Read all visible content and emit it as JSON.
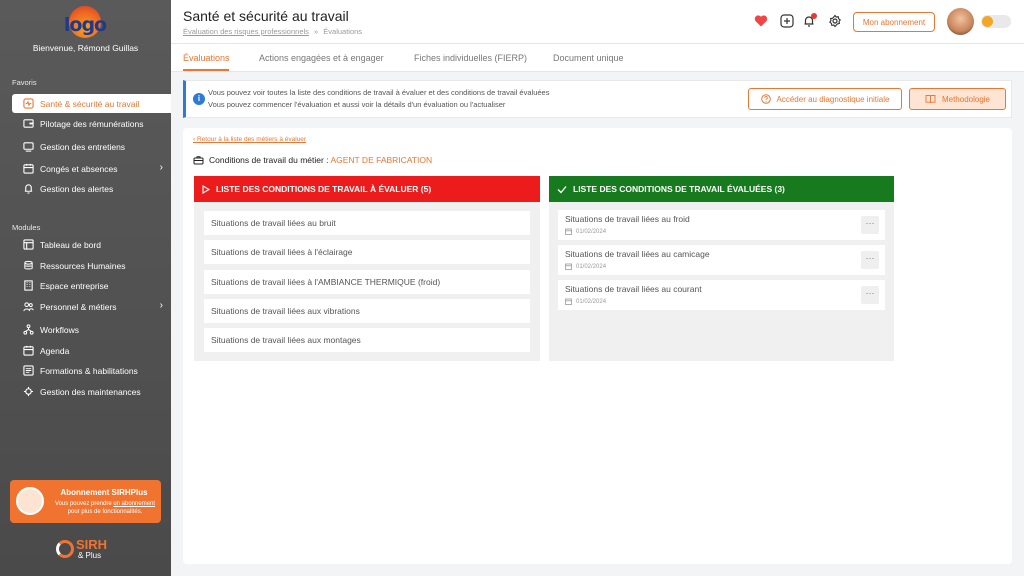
{
  "sidebar": {
    "logo_text": "logo",
    "welcome": "Bienvenue, Rémond Guillas",
    "favoris_title": "Favoris",
    "favoris": [
      {
        "label": "Santé & sécurité au travail",
        "icon": "health-icon",
        "active": true
      },
      {
        "label": "Pilotage des rémunérations",
        "icon": "wallet-icon"
      },
      {
        "label": "Gestion des entretiens",
        "icon": "interview-icon"
      },
      {
        "label": "Congés et absences",
        "icon": "calendar-icon",
        "chevron": "›"
      },
      {
        "label": "Gestion des alertes",
        "icon": "bell-icon"
      }
    ],
    "modules_title": "Modules",
    "modules": [
      {
        "label": "Tableau de bord",
        "icon": "dashboard-icon"
      },
      {
        "label": "Ressources Humaines",
        "icon": "hr-icon"
      },
      {
        "label": "Espace entreprise",
        "icon": "building-icon"
      },
      {
        "label": "Personnel & métiers",
        "icon": "people-icon",
        "chevron": "›"
      },
      {
        "label": "Workflows",
        "icon": "workflow-icon"
      },
      {
        "label": "Agenda",
        "icon": "agenda-icon"
      },
      {
        "label": "Formations & habilitations",
        "icon": "training-icon"
      },
      {
        "label": "Gestion des maintenances",
        "icon": "maintenance-icon"
      }
    ],
    "promo": {
      "title": "Abonnement SIRHPlus",
      "text_before": "Vous pouvez prendre ",
      "link": "un abonnement",
      "text_after": " pour plus de fonctionnalités."
    },
    "brand": {
      "name": "SIRH",
      "sub": "& Plus"
    }
  },
  "header": {
    "title": "Santé et sécurité au travail",
    "breadcrumb": [
      "Évaluation des risques professionnels",
      "Évaluations"
    ],
    "breadcrumb_sep": "»",
    "subscription_button": "Mon abonnement"
  },
  "tabs": [
    {
      "label": "Évaluations",
      "active": true
    },
    {
      "label": "Actions engagées et à engager"
    },
    {
      "label": "Fiches individuelles (FIERP)"
    },
    {
      "label": "Document unique"
    }
  ],
  "info": {
    "icon_glyph": "i",
    "line1": "Vous pouvez voir toutes la liste des conditions de travail à évaluer et des conditions de travail évaluées",
    "line2": "Vous pouvez commencer l'évaluation et aussi voir la détails d'un évaluation ou l'actualiser",
    "diag_button": "Accéder au diagnostique initiale",
    "method_button": "Methodologie"
  },
  "main": {
    "back_link": "Retour à la liste des métiers à évaluer",
    "job_label": "Conditions de travail du métier : ",
    "job_name": "AGENT DE FABRICATION",
    "to_evaluate": {
      "title": "LISTE DES CONDITIONS DE TRAVAIL À ÉVALUER (5)",
      "items": [
        "Situations de travail liées au bruit",
        "Situations de travail liées à l'éclairage",
        "Situations de travail liées à l'AMBIANCE THERMIQUE (froid)",
        "Situations de travail liées aux vibrations",
        "Situations de travail liées aux montages"
      ]
    },
    "evaluated": {
      "title": "LISTE DES CONDITIONS DE TRAVAIL ÉVALUÉES (3)",
      "items": [
        {
          "label": "Situations de travail liées au froid",
          "date": "01/02/2024"
        },
        {
          "label": "Situations de travail liées au camicage",
          "date": "01/02/2024"
        },
        {
          "label": "Situations de travail liées au courant",
          "date": "01/02/2024"
        }
      ],
      "menu_glyph": "···"
    }
  },
  "colors": {
    "accent": "#f07330",
    "red": "#ed1c1c",
    "green": "#177a1e",
    "info": "#2e7bd6"
  }
}
